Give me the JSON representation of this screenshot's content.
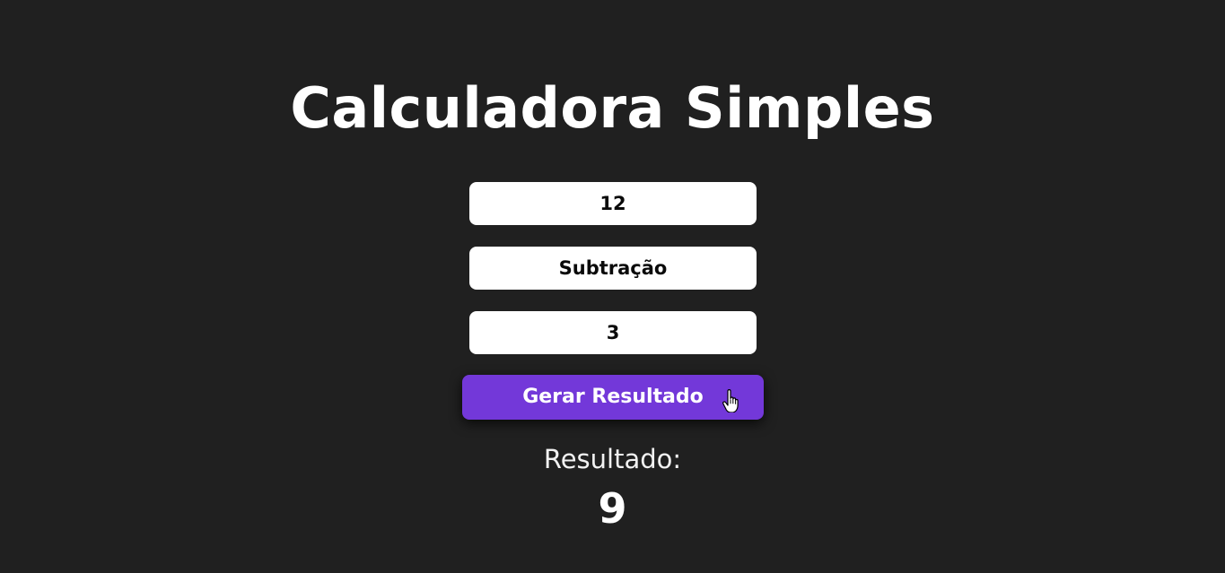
{
  "header": {
    "title": "Calculadora Simples"
  },
  "form": {
    "first_number": "12",
    "operation": "Subtração",
    "second_number": "3",
    "submit_label": "Gerar Resultado"
  },
  "result": {
    "label": "Resultado:",
    "value": "9"
  },
  "cursor": {
    "type": "hand-pointer-icon"
  },
  "colors": {
    "background": "#202020",
    "accent": "#7338d9",
    "field": "#ffffff",
    "text": "#ffffff"
  }
}
